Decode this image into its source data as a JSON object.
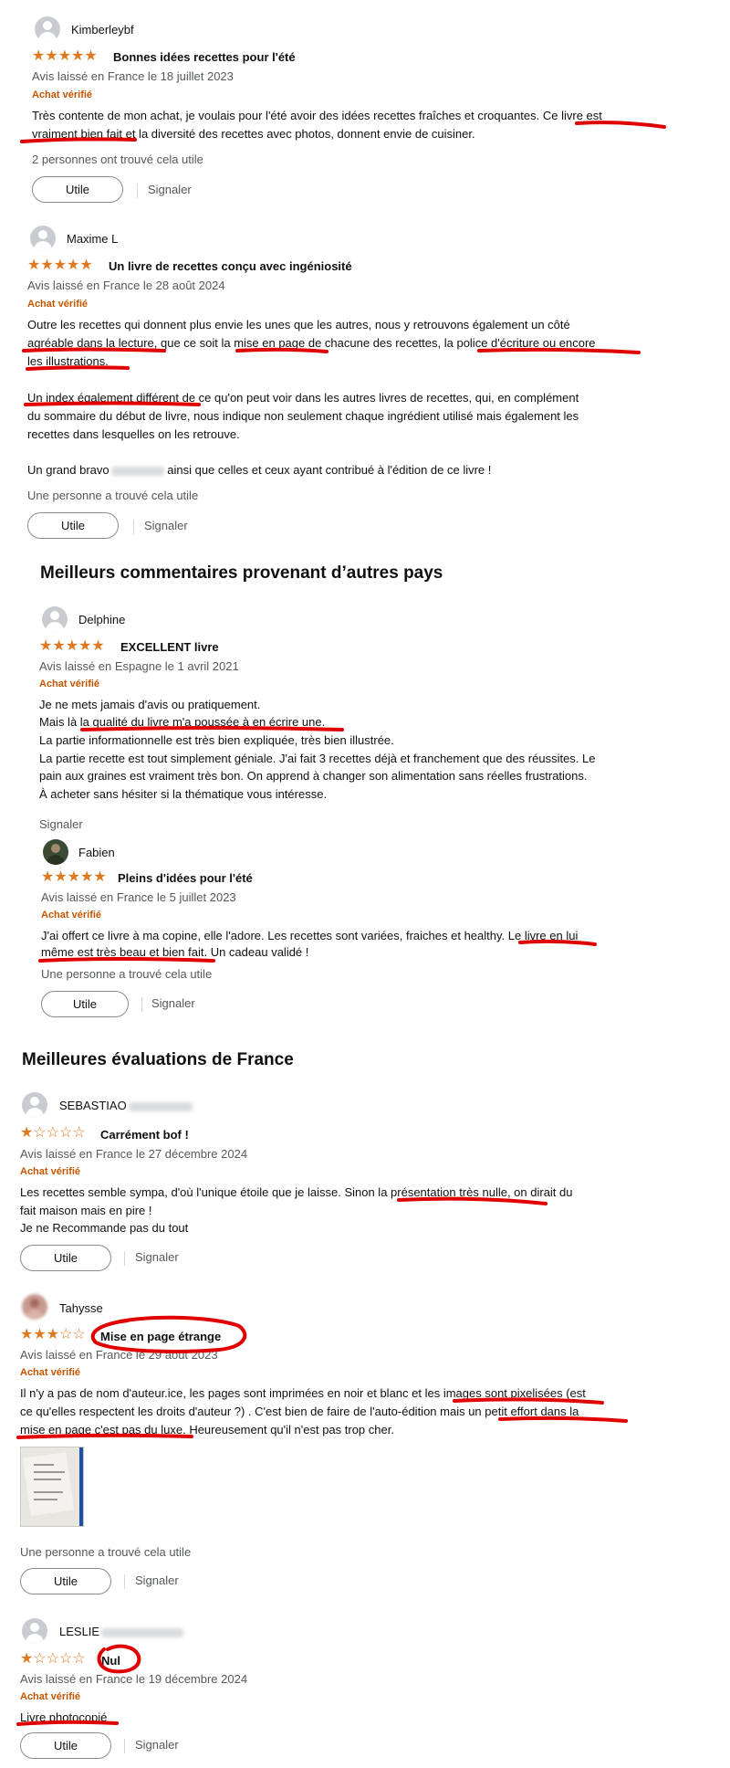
{
  "reviews": [
    {
      "author": "Kimberleybf",
      "rating": 5,
      "title": "Bonnes idées recettes pour l'été",
      "meta": "Avis laissé en France le 18 juillet 2023",
      "verified": "Achat vérifié",
      "lines": [
        "Très contente de mon achat, je voulais pour l'été avoir des idées recettes fraîches et croquantes. Ce livre est",
        "vraiment bien fait et la diversité des recettes avec photos, donnent envie de cuisiner."
      ],
      "helpful": "2 personnes ont trouvé cela utile",
      "button": "Utile",
      "report": "Signaler"
    },
    {
      "author": "Maxime L",
      "rating": 5,
      "title": "Un livre de recettes conçu avec ingéniosité",
      "meta": "Avis laissé en France le 28 août 2024",
      "verified": "Achat vérifié",
      "lines": [
        "Outre les recettes qui donnent plus envie les unes que les autres, nous y retrouvons également un côté",
        "agréable dans la lecture, que ce soit la mise en page de chacune des recettes, la police d'écriture ou encore",
        "les illustrations.",
        "",
        "Un index également différent de ce qu'on peut voir dans les autres livres de recettes, qui, en complément",
        "du sommaire du début de livre, nous indique non seulement chaque ingrédient utilisé mais également les",
        "recettes dans lesquelles on les retrouve.",
        "",
        "Un grand bravo",
        "ainsi que celles et ceux ayant contribué à l'édition de ce livre !"
      ],
      "helpful": "Une personne a trouvé cela utile",
      "button": "Utile",
      "report": "Signaler"
    }
  ],
  "foreign_section": {
    "title": "Meilleurs commentaires provenant d’autres pays",
    "reviews": [
      {
        "author": "Delphine",
        "rating": 5,
        "title": "EXCELLENT livre",
        "meta": "Avis laissé en Espagne le 1 avril 2021",
        "verified": "Achat vérifié",
        "lines": [
          "Je ne mets jamais d'avis ou pratiquement.",
          "Mais là la qualité du livre m'a poussée à en écrire une.",
          "La partie informationnelle est très bien expliquée, très bien illustrée.",
          "La partie recette est tout simplement géniale. J'ai fait 3 recettes déjà et franchement que des réussites. Le",
          "pain aux graines est vraiment très bon. On apprend à changer son alimentation sans réelles frustrations.",
          "À acheter sans hésiter si la thématique vous intéresse."
        ],
        "report": "Signaler"
      },
      {
        "author": "Fabien",
        "rating": 5,
        "title": "Pleins d'idées pour l'été",
        "meta": "Avis laissé en France le 5 juillet 2023",
        "verified": "Achat vérifié",
        "lines": [
          "J'ai offert ce livre à ma copine, elle l'adore. Les recettes sont variées, fraiches et healthy. Le livre en lui",
          "même est très beau et bien fait. Un cadeau validé !"
        ],
        "helpful": "Une personne a trouvé cela utile",
        "button": "Utile",
        "report": "Signaler"
      }
    ]
  },
  "france_section": {
    "title": "Meilleures évaluations de France",
    "reviews": [
      {
        "author": "SEBASTIAO",
        "rating": 1,
        "title": "Carrément bof !",
        "meta": "Avis laissé en France le 27 décembre 2024",
        "verified": "Achat vérifié",
        "lines": [
          "Les recettes semble sympa, d'où l'unique étoile que je laisse. Sinon la présentation très nulle, on dirait du",
          "fait maison mais en pire !",
          "Je ne Recommande pas du tout"
        ],
        "button": "Utile",
        "report": "Signaler"
      },
      {
        "author": "Tahysse",
        "rating": 3,
        "title": "Mise en page étrange",
        "meta": "Avis laissé en France le 29 août 2023",
        "verified": "Achat vérifié",
        "lines": [
          "Il n'y a pas de nom d'auteur.ice, les pages sont imprimées en noir et blanc et les images sont pixelisées (est",
          "ce qu'elles respectent les droits d'auteur ?) . C'est bien de faire de l'auto-édition mais un petit effort dans la",
          "mise en page c'est pas du luxe. Heureusement qu'il n'est pas trop cher."
        ],
        "helpful": "Une personne a trouvé cela utile",
        "button": "Utile",
        "report": "Signaler"
      },
      {
        "author": "LESLIE",
        "rating": 1,
        "title": "Nul",
        "meta": "Avis laissé en France le 19 décembre 2024",
        "verified": "Achat vérifié",
        "lines": [
          "Livre photocopié"
        ],
        "button": "Utile",
        "report": "Signaler"
      }
    ]
  },
  "icons": {
    "star_full": "★",
    "star_empty": "☆",
    "avatar": "user-avatar-icon"
  },
  "colors": {
    "star": "#de7921",
    "verified": "#c45500",
    "annotation": "#e00000"
  }
}
